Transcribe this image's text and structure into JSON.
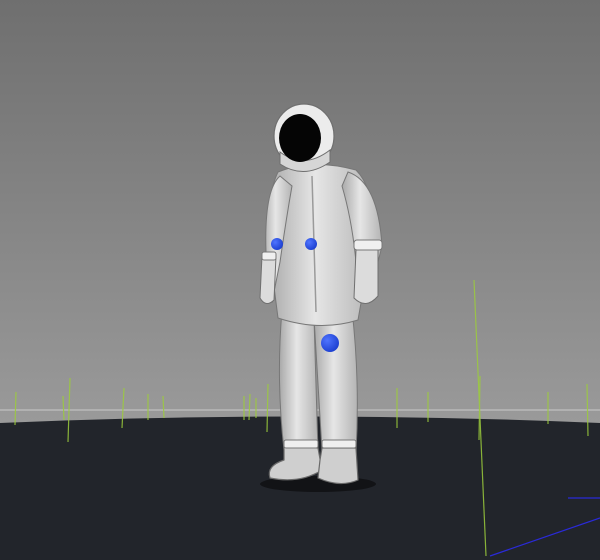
{
  "viewport": {
    "background_top": "#6f6f6f",
    "background_bottom": "#9a9a9a",
    "ground_color": "#22252b",
    "horizon_color": "#c8c8c8",
    "grass_color": "#9ccc3c",
    "axis_color": "#2a2ad8"
  },
  "model": {
    "name": "astronaut-suit",
    "suit_color": "#d8d8d8",
    "visor_color": "#050505",
    "marker_color": "#1c3fd0",
    "marker_count": 3
  }
}
